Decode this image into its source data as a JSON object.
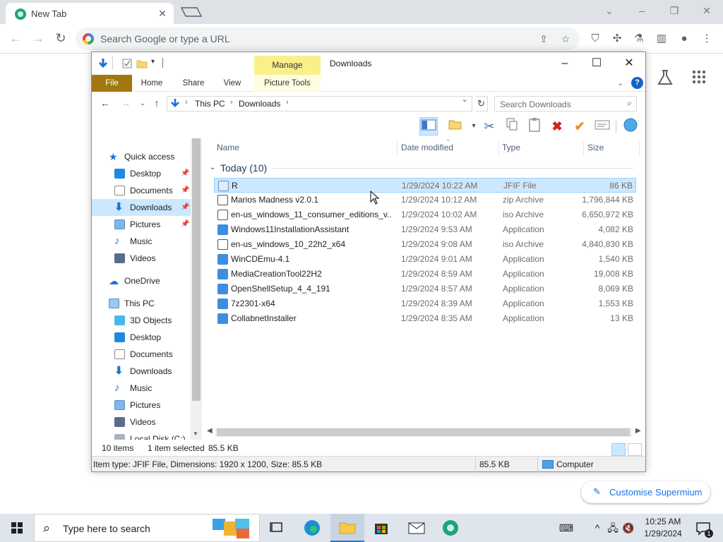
{
  "browser": {
    "tab_title": "New Tab",
    "omnibox_placeholder": "Search Google or type a URL",
    "customise_label": "Customise Supermium"
  },
  "explorer": {
    "window_title": "Downloads",
    "context_tab": "Manage",
    "ribbon_tabs": [
      "File",
      "Home",
      "Share",
      "View",
      "Picture Tools"
    ],
    "breadcrumb": [
      "This PC",
      "Downloads"
    ],
    "search_placeholder": "Search Downloads",
    "nav": {
      "quick_access": "Quick access",
      "quick_items": [
        "Desktop",
        "Documents",
        "Downloads",
        "Pictures",
        "Music",
        "Videos"
      ],
      "onedrive": "OneDrive",
      "this_pc": "This PC",
      "pc_items": [
        "3D Objects",
        "Desktop",
        "Documents",
        "Downloads",
        "Music",
        "Pictures",
        "Videos",
        "Local Disk (C:)"
      ]
    },
    "columns": [
      "Name",
      "Date modified",
      "Type",
      "Size"
    ],
    "group_label": "Today (10)",
    "files": [
      {
        "name": "R",
        "date": "1/29/2024 10:22 AM",
        "type": "JFIF File",
        "size": "86 KB"
      },
      {
        "name": "Marios Madness v2.0.1",
        "date": "1/29/2024 10:12 AM",
        "type": "zip Archive",
        "size": "1,796,844 KB"
      },
      {
        "name": "en-us_windows_11_consumer_editions_v...",
        "date": "1/29/2024 10:02 AM",
        "type": "iso Archive",
        "size": "6,650,972 KB"
      },
      {
        "name": "Windows11InstallationAssistant",
        "date": "1/29/2024 9:53 AM",
        "type": "Application",
        "size": "4,082 KB"
      },
      {
        "name": "en-us_windows_10_22h2_x64",
        "date": "1/29/2024 9:08 AM",
        "type": "iso Archive",
        "size": "4,840,830 KB"
      },
      {
        "name": "WinCDEmu-4.1",
        "date": "1/29/2024 9:01 AM",
        "type": "Application",
        "size": "1,540 KB"
      },
      {
        "name": "MediaCreationTool22H2",
        "date": "1/29/2024 8:59 AM",
        "type": "Application",
        "size": "19,008 KB"
      },
      {
        "name": "OpenShellSetup_4_4_191",
        "date": "1/29/2024 8:57 AM",
        "type": "Application",
        "size": "8,069 KB"
      },
      {
        "name": "7z2301-x64",
        "date": "1/29/2024 8:39 AM",
        "type": "Application",
        "size": "1,553 KB"
      },
      {
        "name": "CollabnetInstaller",
        "date": "1/29/2024 8:35 AM",
        "type": "Application",
        "size": "13 KB"
      }
    ],
    "status": {
      "items": "10 items",
      "selected": "1 item selected",
      "selected_size": "85.5 KB"
    },
    "details": {
      "info": "Item type: JFIF File, Dimensions: 1920 x 1200, Size: 85.5 KB",
      "size": "85.5 KB",
      "location": "Computer"
    }
  },
  "taskbar": {
    "search_placeholder": "Type here to search",
    "time": "10:25 AM",
    "date": "1/29/2024",
    "notification_count": "1"
  }
}
